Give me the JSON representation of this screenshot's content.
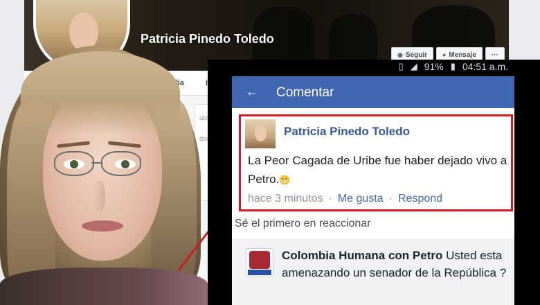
{
  "profile": {
    "name": "Patricia Pinedo Toledo",
    "follow_label": "Seguir",
    "message_label": "Mensaje",
    "more_label": "···",
    "tabs": [
      "fía",
      "I"
    ],
    "side_snippets": [
      "ública",
      "don"
    ]
  },
  "statusbar": {
    "battery": "91%",
    "time": "04:51 a.m."
  },
  "app": {
    "back_icon": "←",
    "title": "Comentar"
  },
  "comment": {
    "author": "Patricia Pinedo Toledo",
    "text": "La Peor Cagada de Uribe fue haber dejado vivo a Petro.",
    "emoji": "😬",
    "time": "hace 3 minutos",
    "like_label": "Me gusta",
    "reply_label": "Respond"
  },
  "first_react": "Sé el primero en reaccionar",
  "reply": {
    "author": "Colombia Humana con Petro",
    "text": "Usted esta amenazando un senador de la República ?"
  },
  "colors": {
    "facebook_blue": "#4267b2",
    "highlight_red": "#d11b23",
    "link_blue": "#365899"
  }
}
